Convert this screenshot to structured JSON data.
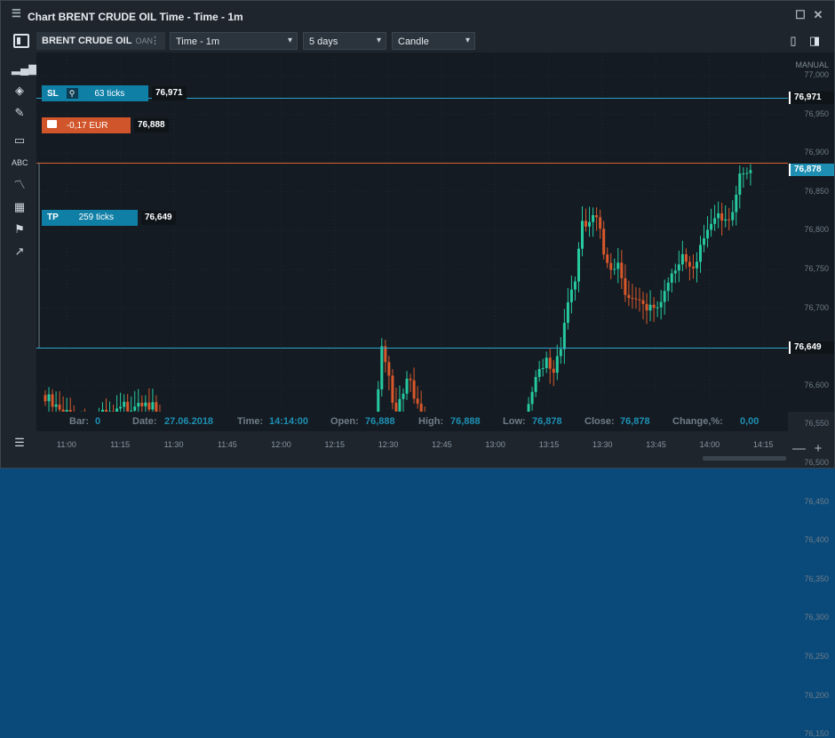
{
  "window": {
    "title": "Chart BRENT CRUDE OIL Time - Time - 1m",
    "menu_icon": "hamburger-icon",
    "restore_icon": "square-icon",
    "close_icon": "close-icon"
  },
  "toolbar": {
    "symbol": "BRENT CRUDE OIL",
    "source": "OAN",
    "more": "⋮",
    "timeframe": "Time - 1m",
    "period": "5 days",
    "chart_type": "Candle"
  },
  "sidebar": {
    "tools": [
      "bar-chart-icon",
      "layers-icon",
      "pencil-icon",
      "ruler-icon",
      "abc-indicator-icon",
      "wave-indicator-icon",
      "grid-icon",
      "flag-icon",
      "arrow-icon"
    ],
    "list_icon": "list-icon"
  },
  "levels": {
    "sl": {
      "tag": "SL",
      "ticks": "63 ticks",
      "price": "76,971",
      "color": "#0f7fa6"
    },
    "position": {
      "pnl": "-0,17 EUR",
      "price": "76,888",
      "color": "#d1552b"
    },
    "tp": {
      "tag": "TP",
      "ticks": "259 ticks",
      "price": "76,649",
      "color": "#0f7fa6"
    }
  },
  "price_axis": {
    "mode": "MANUAL",
    "ticks": [
      "77,000",
      "76,950",
      "76,900",
      "76,850",
      "76,800",
      "76,750",
      "76,700",
      "76,650",
      "76,600",
      "76,550",
      "76,500",
      "76,450",
      "76,400",
      "76,350",
      "76,300",
      "76,250",
      "76,200",
      "76,150"
    ],
    "sl_label": "76,971",
    "current_label": "76,878",
    "tp_label": "76,649",
    "current_color": "#1e8fb3"
  },
  "time_axis": {
    "ticks": [
      "11:00",
      "11:15",
      "11:30",
      "11:45",
      "12:00",
      "12:15",
      "12:30",
      "12:45",
      "13:00",
      "13:15",
      "13:30",
      "13:45",
      "14:00",
      "14:15"
    ]
  },
  "info": {
    "bar_label": "Bar:",
    "bar_value": "0",
    "date_label": "Date:",
    "date_value": "27.06.2018",
    "time_label": "Time:",
    "time_value": "14:14:00",
    "open_label": "Open:",
    "open_value": "76,888",
    "high_label": "High:",
    "high_value": "76,888",
    "low_label": "Low:",
    "low_value": "76,878",
    "close_label": "Close:",
    "close_value": "76,878",
    "change_label": "Change,%:",
    "change_value": "0,00"
  },
  "zoom": {
    "minus": "—",
    "plus": "+"
  },
  "colors": {
    "up": "#26c9a0",
    "down": "#d9582b",
    "background": "#141b22",
    "grid": "#1f2a33"
  },
  "chart_data": {
    "type": "candlestick",
    "x_range": [
      "10:54",
      "14:15"
    ],
    "ylim": [
      76150,
      77000
    ],
    "grid": true,
    "horizontal_lines": [
      {
        "name": "SL",
        "y": 76971
      },
      {
        "name": "Position",
        "y": 76888
      },
      {
        "name": "TP",
        "y": 76649
      }
    ],
    "anchors": [
      [
        0,
        76580
      ],
      [
        5,
        76560
      ],
      [
        10,
        76560
      ],
      [
        15,
        76555
      ],
      [
        20,
        76560
      ],
      [
        24,
        76580
      ],
      [
        28,
        76590
      ],
      [
        32,
        76540
      ],
      [
        34,
        76460
      ],
      [
        36,
        76390
      ],
      [
        38,
        76430
      ],
      [
        42,
        76440
      ],
      [
        45,
        76400
      ],
      [
        48,
        76450
      ],
      [
        50,
        76420
      ],
      [
        53,
        76380
      ],
      [
        55,
        76330
      ],
      [
        58,
        76290
      ],
      [
        62,
        76310
      ],
      [
        64,
        76360
      ],
      [
        66,
        76380
      ],
      [
        68,
        76400
      ],
      [
        70,
        76360
      ],
      [
        72,
        76300
      ],
      [
        74,
        76250
      ],
      [
        76,
        76240
      ],
      [
        78,
        76290
      ],
      [
        80,
        76310
      ],
      [
        82,
        76300
      ],
      [
        85,
        76360
      ],
      [
        88,
        76390
      ],
      [
        90,
        76470
      ],
      [
        92,
        76530
      ],
      [
        94,
        76640
      ],
      [
        96,
        76600
      ],
      [
        98,
        76580
      ],
      [
        100,
        76600
      ],
      [
        102,
        76620
      ],
      [
        104,
        76570
      ],
      [
        106,
        76520
      ],
      [
        108,
        76500
      ],
      [
        111,
        76510
      ],
      [
        113,
        76460
      ],
      [
        115,
        76420
      ],
      [
        118,
        76410
      ],
      [
        120,
        76430
      ],
      [
        122,
        76450
      ],
      [
        124,
        76490
      ],
      [
        126,
        76510
      ],
      [
        128,
        76470
      ],
      [
        130,
        76480
      ],
      [
        132,
        76520
      ],
      [
        134,
        76540
      ],
      [
        136,
        76590
      ],
      [
        138,
        76610
      ],
      [
        140,
        76630
      ],
      [
        142,
        76620
      ],
      [
        144,
        76660
      ],
      [
        146,
        76710
      ],
      [
        148,
        76740
      ],
      [
        150,
        76800
      ],
      [
        152,
        76810
      ],
      [
        154,
        76810
      ],
      [
        156,
        76770
      ],
      [
        158,
        76760
      ],
      [
        160,
        76760
      ],
      [
        162,
        76730
      ],
      [
        164,
        76710
      ],
      [
        166,
        76700
      ],
      [
        168,
        76690
      ],
      [
        170,
        76700
      ],
      [
        172,
        76710
      ],
      [
        174,
        76740
      ],
      [
        176,
        76760
      ],
      [
        178,
        76770
      ],
      [
        180,
        76740
      ],
      [
        182,
        76750
      ],
      [
        184,
        76790
      ],
      [
        186,
        76810
      ],
      [
        188,
        76830
      ],
      [
        190,
        76820
      ],
      [
        192,
        76830
      ],
      [
        194,
        76860
      ],
      [
        196,
        76870
      ],
      [
        197,
        76878
      ]
    ]
  }
}
